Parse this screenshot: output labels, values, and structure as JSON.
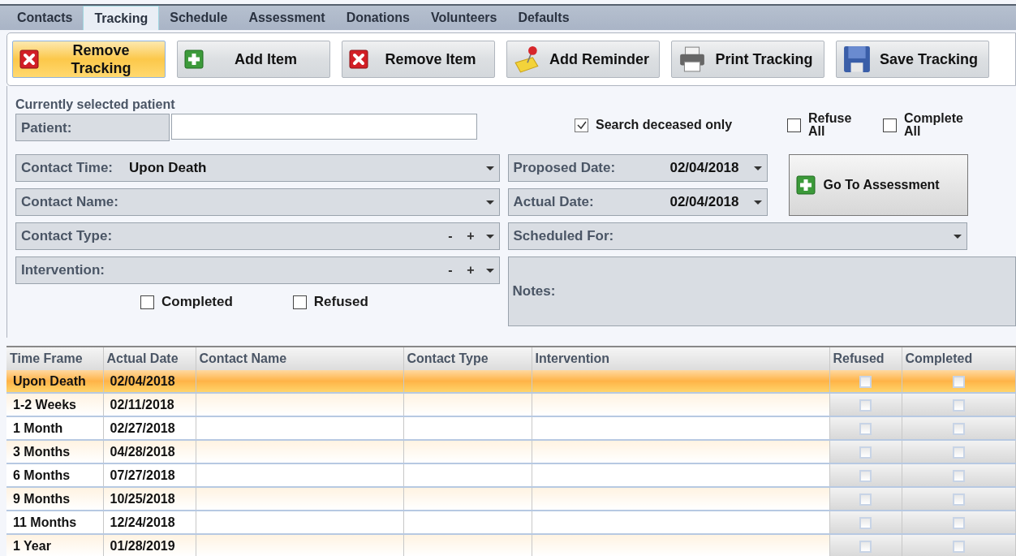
{
  "tabs": [
    {
      "label": "Contacts",
      "selected": false
    },
    {
      "label": "Tracking",
      "selected": true
    },
    {
      "label": "Schedule",
      "selected": false
    },
    {
      "label": "Assessment",
      "selected": false
    },
    {
      "label": "Donations",
      "selected": false
    },
    {
      "label": "Volunteers",
      "selected": false
    },
    {
      "label": "Defaults",
      "selected": false
    }
  ],
  "toolbar": [
    {
      "label": "Remove Tracking",
      "kind": "remove",
      "highlighted": true
    },
    {
      "label": "Add Item",
      "kind": "add",
      "highlighted": false
    },
    {
      "label": "Remove Item",
      "kind": "remove",
      "highlighted": false
    },
    {
      "label": "Add Reminder",
      "kind": "reminder",
      "highlighted": false
    },
    {
      "label": "Print Tracking",
      "kind": "print",
      "highlighted": false
    },
    {
      "label": "Save Tracking",
      "kind": "save",
      "highlighted": false
    }
  ],
  "patient": {
    "section_title": "Currently selected patient",
    "label": "Patient:"
  },
  "filters": [
    {
      "label": "Search deceased only",
      "checked": true
    },
    {
      "label": "Refuse All",
      "checked": false
    },
    {
      "label": "Complete All",
      "checked": false
    }
  ],
  "contact_fields": [
    {
      "label": "Contact Time:",
      "value": "Upon Death",
      "kind": "dropdown"
    },
    {
      "label": "Contact Name:",
      "kind": "dropdown"
    },
    {
      "label": "Contact Type:",
      "kind": "editable",
      "minus": "-",
      "plus": "+"
    },
    {
      "label": "Intervention:",
      "kind": "editable",
      "minus": "-",
      "plus": "+"
    }
  ],
  "status_checks": [
    {
      "label": "Completed",
      "checked": false
    },
    {
      "label": "Refused",
      "checked": false
    }
  ],
  "dates": [
    {
      "label": "Proposed Date:",
      "value": "02/04/2018"
    },
    {
      "label": "Actual Date:",
      "value": "02/04/2018"
    }
  ],
  "assessment_button": "Go To Assessment",
  "scheduled_for": {
    "label": "Scheduled For:"
  },
  "notes": {
    "label": "Notes:"
  },
  "table": {
    "columns": [
      "Time Frame",
      "Actual Date",
      "Contact Name",
      "Contact Type",
      "Intervention",
      "Refused",
      "Completed"
    ],
    "rows": [
      {
        "time_frame": "Upon Death",
        "actual_date": "02/04/2018",
        "refused": false,
        "completed": false,
        "selected": true
      },
      {
        "time_frame": "1-2 Weeks",
        "actual_date": "02/11/2018",
        "refused": false,
        "completed": false,
        "selected": false
      },
      {
        "time_frame": "1 Month",
        "actual_date": "02/27/2018",
        "refused": false,
        "completed": false,
        "selected": false
      },
      {
        "time_frame": "3 Months",
        "actual_date": "04/28/2018",
        "refused": false,
        "completed": false,
        "selected": false
      },
      {
        "time_frame": "6 Months",
        "actual_date": "07/27/2018",
        "refused": false,
        "completed": false,
        "selected": false
      },
      {
        "time_frame": "9 Months",
        "actual_date": "10/25/2018",
        "refused": false,
        "completed": false,
        "selected": false
      },
      {
        "time_frame": "11 Months",
        "actual_date": "12/24/2018",
        "refused": false,
        "completed": false,
        "selected": false
      },
      {
        "time_frame": "1 Year",
        "actual_date": "01/28/2019",
        "refused": false,
        "completed": false,
        "selected": false
      }
    ]
  }
}
